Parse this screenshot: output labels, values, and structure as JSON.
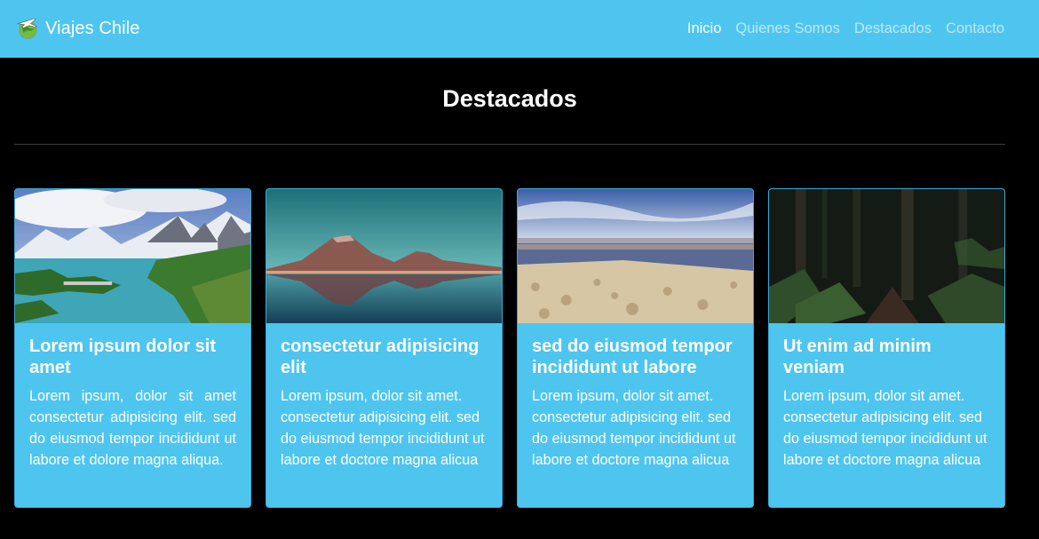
{
  "navbar": {
    "brand": "Viajes Chile",
    "logo_icon": "globe-plane-icon",
    "links": [
      "Inicio",
      "Quienes Somos",
      "Destacados",
      "Contacto"
    ],
    "active": "Inicio"
  },
  "section": {
    "title": "Destacados"
  },
  "cards": [
    {
      "title": "Lorem ipsum dolor sit amet",
      "text": "Lorem ipsum, dolor sit amet consectetur adipisicing elit. sed do eiusmod tempor incididunt ut labore et dolore magna aliqua.",
      "image": "patagonia-lake-mountains-image"
    },
    {
      "title": "consectetur adipisicing elit",
      "text": "Lorem ipsum, dolor sit amet. consectetur adipisicing elit. sed do eiusmod tempor incididunt ut labore et doctore magna alicua",
      "image": "volcano-reflection-image"
    },
    {
      "title": "sed do eiusmod tempor incididunt ut labore",
      "text": "Lorem ipsum, dolor sit amet. consectetur adipisicing elit. sed do eiusmod tempor incididunt ut labore et doctore magna alicua",
      "image": "salt-flat-lagoon-image"
    },
    {
      "title": "Ut enim ad minim veniam",
      "text": "Lorem ipsum, dolor sit amet. consectetur adipisicing elit. sed do eiusmod tempor incididunt ut labore et doctore magna alicua",
      "image": "forest-ferns-image"
    }
  ],
  "colors": {
    "primary": "#4ec5ef",
    "background": "#000000"
  }
}
